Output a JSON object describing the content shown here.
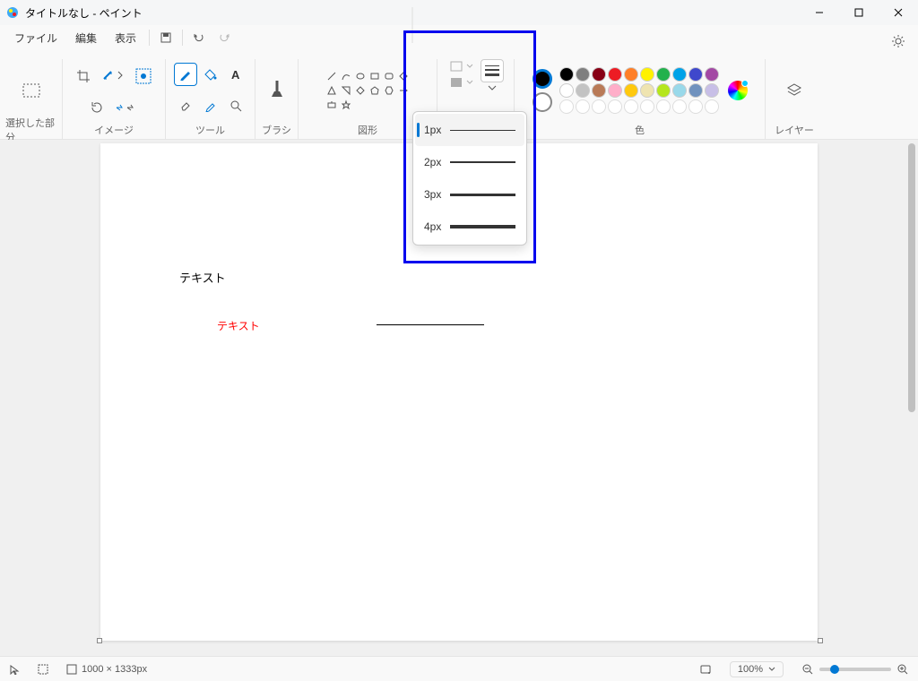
{
  "window": {
    "title": "タイトルなし - ペイント"
  },
  "menu": {
    "file": "ファイル",
    "edit": "編集",
    "view": "表示"
  },
  "ribbon": {
    "selection_label": "選択した部分",
    "image_label": "イメージ",
    "tool_label": "ツール",
    "brush_label": "ブラシ",
    "shape_label": "図形",
    "color_label": "色",
    "layer_label": "レイヤー"
  },
  "thickness": {
    "items": [
      "1px",
      "2px",
      "3px",
      "4px"
    ],
    "selected": "1px"
  },
  "palette_row1": [
    "#000000",
    "#7f7f7f",
    "#880015",
    "#ed1c24",
    "#ff7f27",
    "#fff200",
    "#22b14c",
    "#00a2e8",
    "#3f48cc",
    "#a349a4"
  ],
  "palette_row2": [
    "#ffffff",
    "#c3c3c3",
    "#b97a57",
    "#ffaec9",
    "#ffc90e",
    "#efe4b0",
    "#b5e61d",
    "#99d9ea",
    "#7092be",
    "#c8bfe7"
  ],
  "palette_row3_empty": [
    "",
    "",
    "",
    "",
    "",
    "",
    "",
    "",
    "",
    ""
  ],
  "canvas": {
    "text1": "テキスト",
    "text2": "テキスト",
    "size_label": "1000 × 1333px"
  },
  "status": {
    "zoom": "100%"
  }
}
